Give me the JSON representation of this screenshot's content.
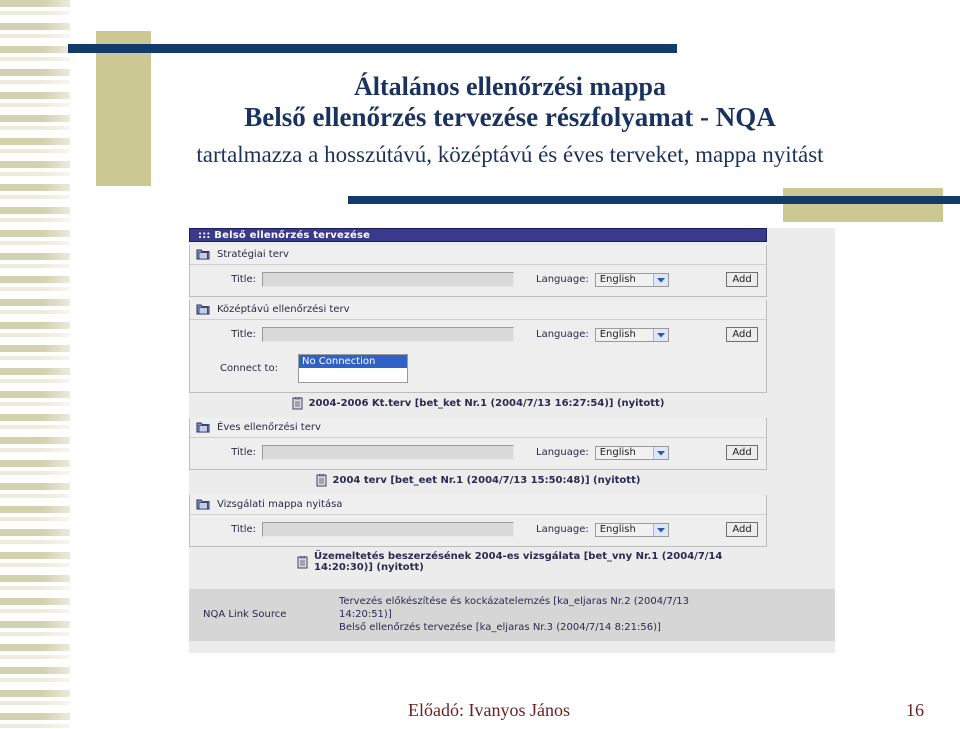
{
  "slide": {
    "heading_line1": "Általános ellenőrzési mappa",
    "heading_line2": "Belső ellenőrzés tervezése részfolyamat - NQA",
    "heading_line3": "tartalmazza a  hosszútávú, középtávú és éves terveket, mappa nyitást",
    "accent_navy": "#123a6b",
    "accent_khaki": "#cbc894",
    "footer_presenter": "Előadó: Ivanyos János",
    "footer_page_number": "16"
  },
  "app": {
    "titlebar": "::: Belső ellenőrzés tervezése",
    "labels": {
      "title": "Title:",
      "language": "Language:",
      "add": "Add",
      "connect_to": "Connect to:"
    },
    "sections": [
      {
        "name": "Stratégiai terv",
        "title_value": "",
        "language": "English",
        "add": "Add"
      },
      {
        "name": "Középtávú ellenőrzési terv",
        "title_value": "",
        "language": "English",
        "add": "Add",
        "connect_label": "Connect to:",
        "connect_options": [
          "No Connection",
          ""
        ],
        "connect_selected": "No Connection"
      },
      {
        "name": "Éves ellenőrzési terv",
        "title_value": "",
        "language": "English",
        "add": "Add"
      },
      {
        "name": "Vizsgálati mappa nyitása",
        "title_value": "",
        "language": "English",
        "add": "Add"
      }
    ],
    "documents": {
      "after_section2": "2004-2006 Kt.terv [bet_ket Nr.1 (2004/7/13 16:27:54)] (nyitott)",
      "after_section3": "2004 terv [bet_eet Nr.1 (2004/7/13 15:50:48)] (nyitott)",
      "after_section4": "Üzemeltetés beszerzésének 2004-es vizsgálata [bet_vny Nr.1 (2004/7/14 14:20:30)] (nyitott)"
    },
    "nqa_link_source": {
      "label": "NQA Link Source",
      "line1": "Tervezés előkészítése és kockázatelemzés [ka_eljaras Nr.2 (2004/7/13",
      "line2": "14:20:51)]",
      "line3": "Belső ellenőrzés tervezése [ka_eljaras Nr.3 (2004/7/14 8:21:56)]"
    }
  }
}
